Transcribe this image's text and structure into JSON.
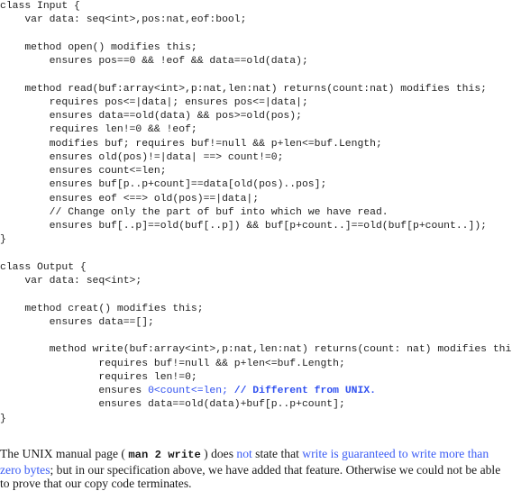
{
  "code": {
    "lines": [
      "class Input {",
      "    var data: seq<int>,pos:nat,eof:bool;",
      "",
      "    method open() modifies this;",
      "        ensures pos==0 && !eof && data==old(data);",
      "",
      "    method read(buf:array<int>,p:nat,len:nat) returns(count:nat) modifies this;",
      "        requires pos<=|data|; ensures pos<=|data|;",
      "        ensures data==old(data) && pos>=old(pos);",
      "        requires len!=0 && !eof;",
      "        modifies buf; requires buf!=null && p+len<=buf.Length;",
      "        ensures old(pos)!=|data| ==> count!=0;",
      "        ensures count<=len;",
      "        ensures buf[p..p+count]==data[old(pos)..pos];",
      "        ensures eof <==> old(pos)==|data|;",
      "        // Change only the part of buf into which we have read.",
      "        ensures buf[..p]==old(buf[..p]) && buf[p+count..]==old(buf[p+count..]);",
      "}",
      "",
      "class Output {",
      "    var data: seq<int>;",
      "",
      "    method creat() modifies this;",
      "        ensures data==[];",
      "",
      "        method write(buf:array<int>,p:nat,len:nat) returns(count: nat) modifies this;",
      "                requires buf!=null && p+len<=buf.Length;",
      "                requires len!=0;"
    ],
    "highlighted_line": {
      "prefix": "                ensures ",
      "blue_code": "0<count<=len;",
      "space": " ",
      "blue_comment": "// Different from UNIX."
    },
    "tail_lines": [
      "                ensures data==old(data)+buf[p..p+count];",
      "}"
    ]
  },
  "prose": {
    "t1": "The UNIX manual page ( ",
    "tt": "man 2 write",
    "t2": " ) does ",
    "blue1": "not",
    "t3": " state that ",
    "blue2": "write is guaranteed to write more than zero bytes",
    "t4": "; but in our specification above, we have added that feature. Otherwise we could not be able to prove that our copy code terminates."
  },
  "colors": {
    "text": "#1e1e1e",
    "highlight_blue": "#2f50f0"
  }
}
